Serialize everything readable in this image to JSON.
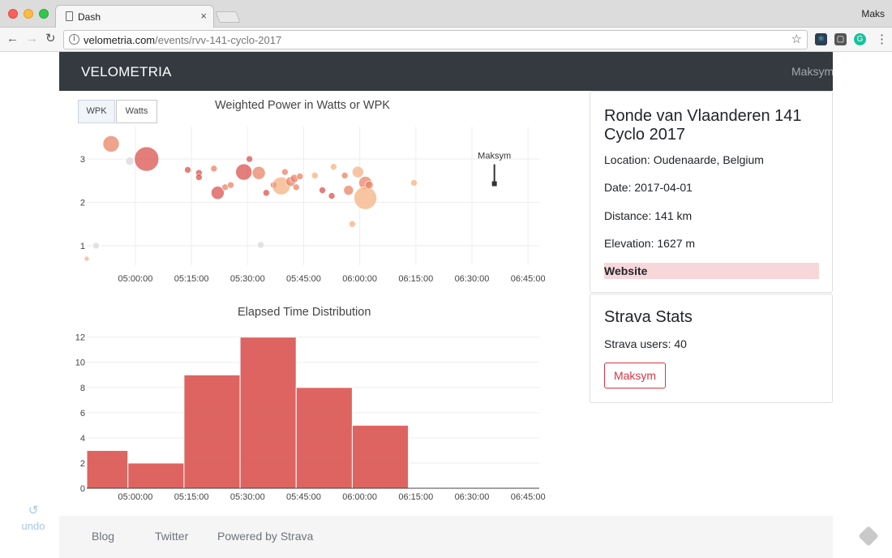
{
  "browser": {
    "tab_title": "Dash",
    "tab_close": "×",
    "profile": "Maks",
    "url_host": "velometria.com",
    "url_path": "/events/rvv-141-cyclo-2017",
    "back_glyph": "←",
    "forward_glyph": "→",
    "reload_glyph": "↻",
    "info_glyph": "i",
    "star_glyph": "☆",
    "menu_glyph": "⋮",
    "extensions": [
      "react-devtools-icon",
      "shield-extension-icon",
      "grammarly-icon"
    ]
  },
  "navbar": {
    "brand": "VELOMETRIA",
    "user": "Maksym"
  },
  "power_chart": {
    "toggles": [
      "WPK",
      "Watts"
    ],
    "active_toggle": "WPK"
  },
  "event": {
    "title": "Ronde van Vlaanderen 141 Cyclo 2017",
    "location": "Location: Oudenaarde, Belgium",
    "date": "Date: 2017-04-01",
    "distance": "Distance: 141 km",
    "elevation": "Elevation: 1627 m",
    "website": "Website"
  },
  "strava": {
    "title": "Strava Stats",
    "users": "Strava users: 40",
    "user_button": "Maksym"
  },
  "footer": {
    "links": [
      "Blog",
      "Twitter",
      "Powered by Strava"
    ]
  },
  "undo": {
    "label": "undo",
    "glyph": "↺"
  },
  "chart_data": [
    {
      "type": "scatter",
      "title": "Weighted Power in Watts or WPK",
      "xlabel": "",
      "ylabel": "",
      "x_ticks": [
        "05:00:00",
        "05:15:00",
        "05:30:00",
        "05:45:00",
        "06:00:00",
        "06:15:00",
        "06:30:00",
        "06:45:00"
      ],
      "y_ticks": [
        1,
        2,
        3
      ],
      "xlim": [
        "04:47:00",
        "06:48:00"
      ],
      "ylim": [
        0.55,
        3.75
      ],
      "grid": true,
      "colors": {
        "low": "#f5b183",
        "mid": "#ea8366",
        "high": "#d9534f",
        "faded": "#d8d8d8"
      },
      "points": [
        {
          "x": "04:47:00",
          "y": 0.7,
          "size": 3,
          "shade": "low"
        },
        {
          "x": "04:49:30",
          "y": 1.0,
          "size": 4,
          "shade": "faded"
        },
        {
          "x": "04:53:30",
          "y": 3.35,
          "size": 10,
          "shade": "mid"
        },
        {
          "x": "05:03:00",
          "y": 3.0,
          "size": 15,
          "shade": "high"
        },
        {
          "x": "04:58:30",
          "y": 2.95,
          "size": 5,
          "shade": "faded"
        },
        {
          "x": "05:14:00",
          "y": 2.75,
          "size": 4,
          "shade": "high"
        },
        {
          "x": "05:17:00",
          "y": 2.68,
          "size": 4,
          "shade": "high"
        },
        {
          "x": "05:17:00",
          "y": 2.58,
          "size": 4,
          "shade": "high"
        },
        {
          "x": "05:21:00",
          "y": 2.78,
          "size": 4,
          "shade": "mid"
        },
        {
          "x": "05:22:00",
          "y": 2.22,
          "size": 8,
          "shade": "high"
        },
        {
          "x": "05:24:00",
          "y": 2.35,
          "size": 4,
          "shade": "mid"
        },
        {
          "x": "05:25:30",
          "y": 2.4,
          "size": 4,
          "shade": "mid"
        },
        {
          "x": "05:29:00",
          "y": 2.7,
          "size": 10,
          "shade": "high"
        },
        {
          "x": "05:30:30",
          "y": 3.0,
          "size": 4,
          "shade": "high"
        },
        {
          "x": "05:33:00",
          "y": 2.68,
          "size": 8,
          "shade": "mid"
        },
        {
          "x": "05:33:30",
          "y": 1.02,
          "size": 4,
          "shade": "faded"
        },
        {
          "x": "05:35:00",
          "y": 2.22,
          "size": 4,
          "shade": "high"
        },
        {
          "x": "05:37:00",
          "y": 2.4,
          "size": 4,
          "shade": "high"
        },
        {
          "x": "05:39:00",
          "y": 2.38,
          "size": 11,
          "shade": "low"
        },
        {
          "x": "05:40:00",
          "y": 2.7,
          "size": 4,
          "shade": "mid"
        },
        {
          "x": "05:41:30",
          "y": 2.48,
          "size": 6,
          "shade": "mid"
        },
        {
          "x": "05:42:30",
          "y": 2.55,
          "size": 5,
          "shade": "mid"
        },
        {
          "x": "05:43:00",
          "y": 2.35,
          "size": 4,
          "shade": "mid"
        },
        {
          "x": "05:44:00",
          "y": 2.6,
          "size": 4,
          "shade": "mid"
        },
        {
          "x": "05:48:00",
          "y": 2.62,
          "size": 4,
          "shade": "low"
        },
        {
          "x": "05:50:00",
          "y": 2.28,
          "size": 4,
          "shade": "high"
        },
        {
          "x": "05:52:30",
          "y": 2.15,
          "size": 4,
          "shade": "high"
        },
        {
          "x": "05:53:00",
          "y": 2.82,
          "size": 4,
          "shade": "low"
        },
        {
          "x": "05:56:00",
          "y": 2.62,
          "size": 4,
          "shade": "mid"
        },
        {
          "x": "05:57:00",
          "y": 2.28,
          "size": 6,
          "shade": "mid"
        },
        {
          "x": "05:58:00",
          "y": 1.5,
          "size": 4,
          "shade": "low"
        },
        {
          "x": "05:59:30",
          "y": 2.7,
          "size": 7,
          "shade": "low"
        },
        {
          "x": "06:01:30",
          "y": 2.45,
          "size": 8,
          "shade": "mid"
        },
        {
          "x": "06:01:30",
          "y": 2.1,
          "size": 14,
          "shade": "low"
        },
        {
          "x": "06:02:30",
          "y": 2.4,
          "size": 5,
          "shade": "mid"
        },
        {
          "x": "06:14:30",
          "y": 2.45,
          "size": 4,
          "shade": "low"
        }
      ],
      "highlight": {
        "x": "06:36:00",
        "y": 2.43,
        "label": "Maksym",
        "color": "#333333"
      }
    },
    {
      "type": "bar",
      "title": "Elapsed Time Distribution",
      "xlabel": "",
      "ylabel": "",
      "x_ticks": [
        "05:00:00",
        "05:15:00",
        "05:30:00",
        "05:45:00",
        "06:00:00",
        "06:15:00",
        "06:30:00",
        "06:45:00"
      ],
      "y_ticks": [
        0,
        2,
        4,
        6,
        8,
        10,
        12
      ],
      "xlim": [
        "04:47:00",
        "06:48:00"
      ],
      "ylim": [
        0,
        12.3
      ],
      "grid": true,
      "color": "#d9534f",
      "bins": [
        {
          "start": "04:47:00",
          "end": "04:58:00",
          "count": 3
        },
        {
          "start": "04:58:00",
          "end": "05:13:00",
          "count": 2
        },
        {
          "start": "05:13:00",
          "end": "05:28:00",
          "count": 9
        },
        {
          "start": "05:28:00",
          "end": "05:43:00",
          "count": 12
        },
        {
          "start": "05:43:00",
          "end": "05:58:00",
          "count": 8
        },
        {
          "start": "05:58:00",
          "end": "06:13:00",
          "count": 5
        }
      ]
    }
  ]
}
